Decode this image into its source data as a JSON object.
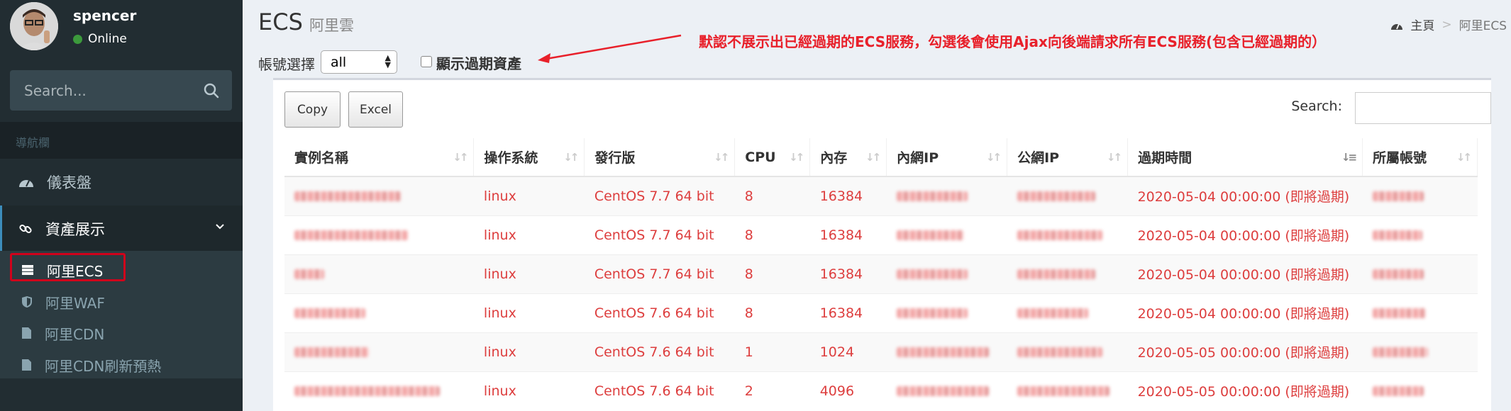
{
  "user": {
    "name": "spencer",
    "status": "Online"
  },
  "sidebar": {
    "search_placeholder": "Search...",
    "header": "導航欄",
    "items": [
      {
        "label": "儀表盤",
        "icon": "dashboard-icon"
      },
      {
        "label": "資產展示",
        "icon": "link-icon"
      }
    ],
    "subitems": [
      {
        "label": "阿里ECS",
        "icon": "server-icon"
      },
      {
        "label": "阿里WAF",
        "icon": "shield-icon"
      },
      {
        "label": "阿里CDN",
        "icon": "file-icon"
      },
      {
        "label": "阿里CDN刷新預熱",
        "icon": "file-icon"
      }
    ]
  },
  "header": {
    "title": "ECS",
    "subtitle": "阿里雲",
    "breadcrumb": [
      "主頁",
      "阿里ECS"
    ]
  },
  "filters": {
    "account_label": "帳號選擇",
    "account_value": "all",
    "expired_label": "顯示過期資產",
    "expired_checked": false
  },
  "annotation": "默認不展示出已經過期的ECS服務，勾選後會使用Ajax向後端請求所有ECS服務(包含已經過期的）",
  "toolbar": {
    "copy_label": "Copy",
    "excel_label": "Excel",
    "search_label": "Search:"
  },
  "table": {
    "columns": [
      "實例名稱",
      "操作系統",
      "發行版",
      "CPU",
      "內存",
      "內網IP",
      "公網IP",
      "過期時間",
      "所屬帳號"
    ],
    "rows": [
      {
        "os": "linux",
        "distro": "CentOS 7.7 64 bit",
        "cpu": "8",
        "mem": "16384",
        "expire": "2020-05-04 00:00:00 (即將過期)"
      },
      {
        "os": "linux",
        "distro": "CentOS 7.7 64 bit",
        "cpu": "8",
        "mem": "16384",
        "expire": "2020-05-04 00:00:00 (即將過期)"
      },
      {
        "os": "linux",
        "distro": "CentOS 7.7 64 bit",
        "cpu": "8",
        "mem": "16384",
        "expire": "2020-05-04 00:00:00 (即將過期)"
      },
      {
        "os": "linux",
        "distro": "CentOS 7.6 64 bit",
        "cpu": "8",
        "mem": "16384",
        "expire": "2020-05-04 00:00:00 (即將過期)"
      },
      {
        "os": "linux",
        "distro": "CentOS 7.6 64 bit",
        "cpu": "1",
        "mem": "1024",
        "expire": "2020-05-05 00:00:00 (即將過期)"
      },
      {
        "os": "linux",
        "distro": "CentOS 7.6 64 bit",
        "cpu": "2",
        "mem": "4096",
        "expire": "2020-05-05 00:00:00 (即將過期)"
      }
    ]
  },
  "colors": {
    "sidebar_bg": "#222d32",
    "accent_red": "#dd3e3e",
    "annotation_red": "#e8202a",
    "online_green": "#3c9a3c"
  }
}
